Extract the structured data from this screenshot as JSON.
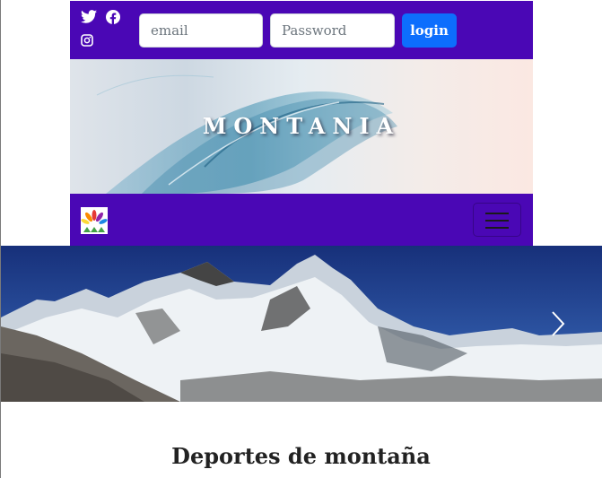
{
  "social": {
    "icons": [
      "twitter-icon",
      "facebook-icon",
      "instagram-icon"
    ]
  },
  "login_form": {
    "email_placeholder": "email",
    "password_placeholder": "Password",
    "button_label": "login"
  },
  "banner": {
    "brand": "MONTANIA"
  },
  "navbar": {
    "logo": "logo-icon",
    "menu": "hamburger-menu-icon"
  },
  "hero": {
    "next": "chevron-right-icon"
  },
  "main": {
    "heading": "Deportes de montaña"
  },
  "colors": {
    "bar": "#4a07b5",
    "login_button": "#0d6efd"
  }
}
